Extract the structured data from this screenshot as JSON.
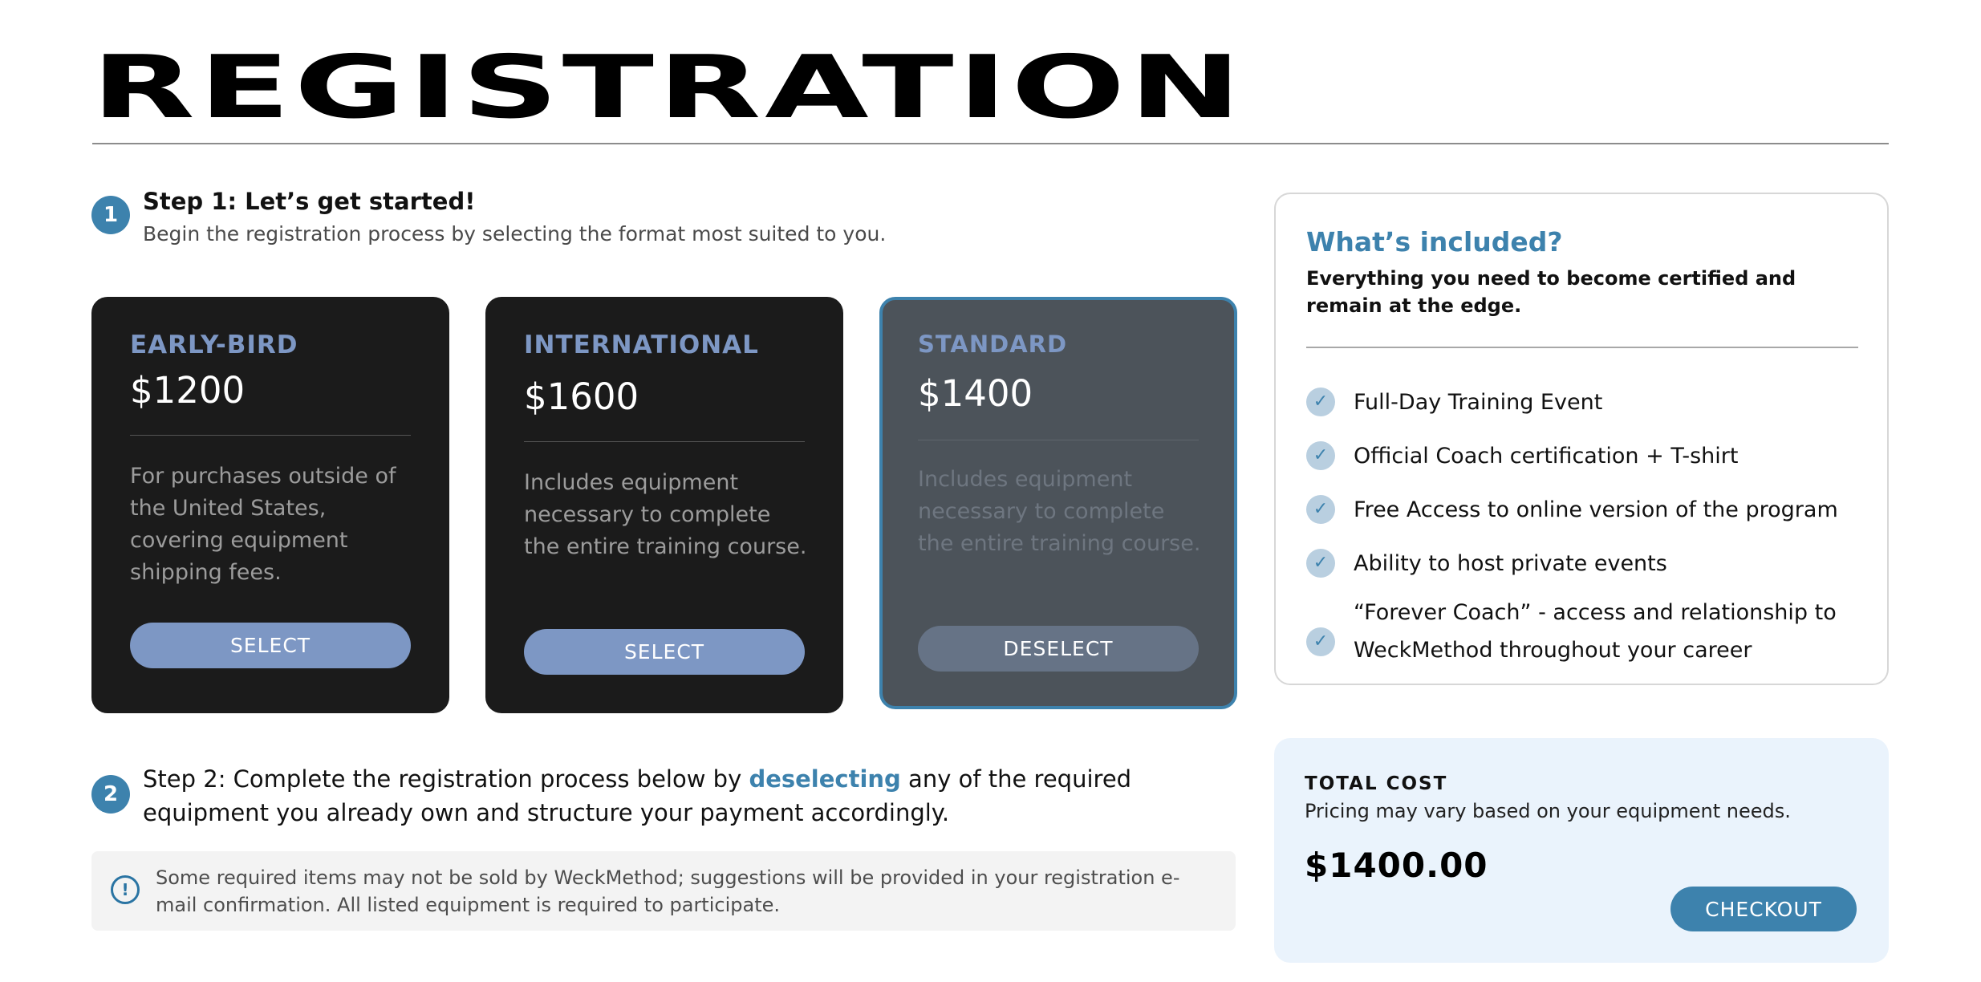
{
  "header": {
    "title": "REGISTRATION"
  },
  "step1": {
    "number": "1",
    "title": "Step 1: Let’s get started!",
    "description": "Begin the registration process by selecting the format most suited to you."
  },
  "cards": [
    {
      "label": "EARLY-BIRD",
      "price": "$1200",
      "description": "For purchases outside of the United States, covering equipment shipping fees.",
      "button_label": "SELECT",
      "selected": false
    },
    {
      "label": "INTERNATIONAL",
      "price": "$1600",
      "description": "Includes equipment necessary to complete the entire training course.",
      "button_label": "SELECT",
      "selected": false
    },
    {
      "label": "STANDARD",
      "price": "$1400",
      "description": "Includes equipment necessary to complete the entire training course.",
      "button_label": "DESELECT",
      "selected": true
    }
  ],
  "step2": {
    "number": "2",
    "text_before": "Step 2: Complete the registration process below by ",
    "link_text": "deselecting",
    "text_after": " any of the required equipment you already own and structure your payment accordingly."
  },
  "notice": {
    "icon": "info-icon",
    "text": "Some required items may not be sold by WeckMethod; suggestions will be provided in your registration e-mail confirmation. All listed equipment is required to participate."
  },
  "included": {
    "title": "What’s included?",
    "subtitle": "Everything you need to become certified and remain at the edge.",
    "items": [
      "Full-Day Training Event",
      "Official Coach certification + T-shirt",
      "Free Access to online version of the program",
      "Ability to host private events",
      "“Forever Coach” - access and relationship to WeckMethod throughout your career"
    ]
  },
  "total": {
    "label": "TOTAL COST",
    "note": "Pricing may vary based on your equipment needs.",
    "amount": "$1400.00",
    "checkout_label": "CHECKOUT"
  },
  "colors": {
    "accent": "#3d82ad",
    "card_bg": "#1b1b1b",
    "card_selected_bg": "#4c535a",
    "card_label": "#7d97c4",
    "total_bg": "#eaf3fc"
  }
}
